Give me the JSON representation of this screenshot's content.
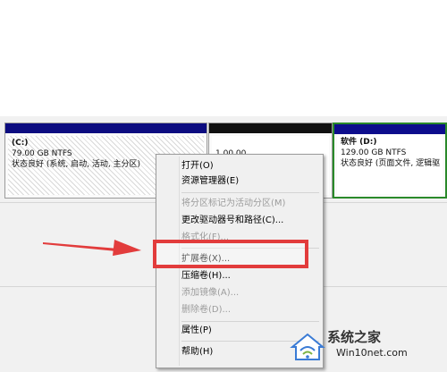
{
  "partitions": {
    "c": {
      "name": "(C:)",
      "size": "79.00 GB NTFS",
      "status": "状态良好 (系统, 启动, 活动, 主分区)"
    },
    "e": {
      "partial_text": "1.00.00"
    },
    "d": {
      "name": "软件 (D:)",
      "size": "129.00 GB NTFS",
      "status": "状态良好 (页面文件, 逻辑驱"
    }
  },
  "context_menu": {
    "items": [
      {
        "label": "打开(O)",
        "enabled": true
      },
      {
        "label": "资源管理器(E)",
        "enabled": true
      },
      {
        "label": "将分区标记为活动分区(M)",
        "enabled": false
      },
      {
        "label": "更改驱动器号和路径(C)...",
        "enabled": true
      },
      {
        "label": "格式化(F)...",
        "enabled": false
      },
      {
        "label": "扩展卷(X)...",
        "enabled": true
      },
      {
        "label": "压缩卷(H)...",
        "enabled": true
      },
      {
        "label": "添加镜像(A)...",
        "enabled": false
      },
      {
        "label": "删除卷(D)...",
        "enabled": false
      },
      {
        "label": "属性(P)",
        "enabled": true
      },
      {
        "label": "帮助(H)",
        "enabled": true
      }
    ]
  },
  "watermark": {
    "text": "系统之家",
    "url": "Win10net.com"
  },
  "colors": {
    "highlight": "#e23c3c",
    "volume_bar": "#0c0c80",
    "selected_border": "#2a8a2a"
  }
}
